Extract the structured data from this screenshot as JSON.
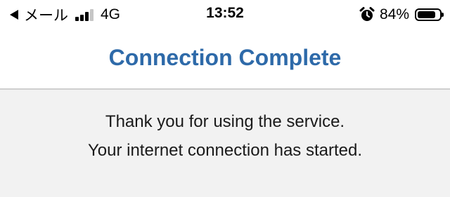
{
  "status_bar": {
    "back_label": "メール",
    "network": "4G",
    "time": "13:52",
    "battery_percent_label": "84%",
    "battery_level": 0.84,
    "signal_bars_filled": 3,
    "signal_bars_total": 4,
    "icons": [
      "back-arrow-icon",
      "signal-icon",
      "alarm-icon",
      "battery-icon"
    ]
  },
  "header": {
    "title": "Connection Complete",
    "title_color": "#2e6aa9"
  },
  "message": {
    "line1": "Thank you for using the service.",
    "line2": "Your internet connection has started."
  }
}
